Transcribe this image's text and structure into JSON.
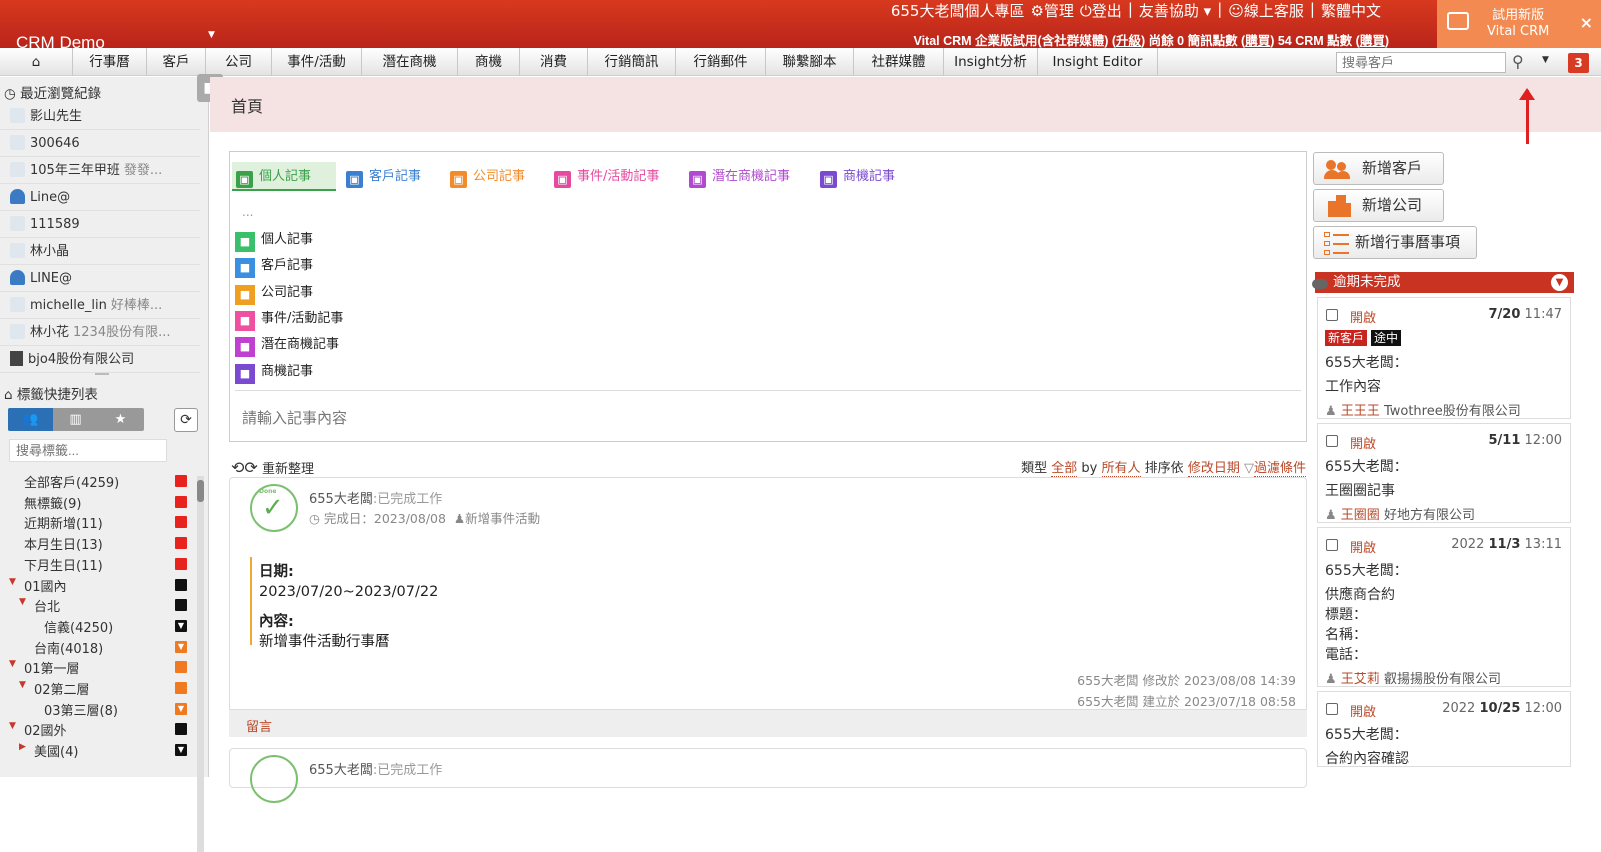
{
  "app": {
    "logo": "CRM Demo",
    "top_links": [
      "655大老闆個人專區",
      "管理",
      "登出",
      "|",
      "友善協助",
      "|",
      "線上客服",
      "|",
      "繁體中文"
    ],
    "account_line_pre": "Vital CRM 企業版試用(含社群媒體) (",
    "account_upgrade": "升級",
    "account_mid": ") 尚餘 0 簡訊點數 (",
    "account_buy1": "購買",
    "account_mid2": ") 54 CRM 點數 (",
    "account_buy2": "購買",
    "account_post": ")",
    "try_new_line1": "試用新版",
    "try_new_line2": "Vital CRM",
    "close": "×",
    "notif_count": "3"
  },
  "nav": [
    "行事曆",
    "客戶",
    "公司",
    "事件/活動",
    "潛在商機",
    "商機",
    "消費",
    "行銷簡訊",
    "行銷郵件",
    "聯繫腳本",
    "社群媒體",
    "Insight分析",
    "Insight Editor"
  ],
  "search": {
    "placeholder": "搜尋客戶"
  },
  "sidebar": {
    "recent_title": "最近瀏覽紀錄",
    "recent": [
      {
        "name": "影山先生",
        "sub": "",
        "type": "person"
      },
      {
        "name": "300646",
        "sub": "",
        "type": "person"
      },
      {
        "name": "105年三年甲班",
        "sub": "發發...",
        "type": "person"
      },
      {
        "name": "Line@",
        "sub": "",
        "type": "group"
      },
      {
        "name": "111589",
        "sub": "",
        "type": "person"
      },
      {
        "name": "林小晶",
        "sub": "",
        "type": "person"
      },
      {
        "name": "LINE@",
        "sub": "",
        "type": "group"
      },
      {
        "name": "michelle_lin",
        "sub": "好棒棒...",
        "type": "person"
      },
      {
        "name": "林小花",
        "sub": "1234股份有限...",
        "type": "person"
      },
      {
        "name": "bjo4股份有限公司",
        "sub": "",
        "type": "company"
      }
    ],
    "tags_title": "標籤快捷列表",
    "tag_search_placeholder": "搜尋標籤...",
    "tags": [
      {
        "label": "全部客戶(4259)",
        "indent": 0,
        "arrow": "",
        "color": "#e8231d",
        "mark": ""
      },
      {
        "label": "無標籤(9)",
        "indent": 0,
        "arrow": "",
        "color": "#e8231d",
        "mark": ""
      },
      {
        "label": "近期新增(11)",
        "indent": 0,
        "arrow": "",
        "color": "#e8231d",
        "mark": ""
      },
      {
        "label": "本月生日(13)",
        "indent": 0,
        "arrow": "",
        "color": "#e8231d",
        "mark": ""
      },
      {
        "label": "下月生日(11)",
        "indent": 0,
        "arrow": "",
        "color": "#e8231d",
        "mark": ""
      },
      {
        "label": "01國內",
        "indent": 0,
        "arrow": "down",
        "color": "#111111",
        "mark": ""
      },
      {
        "label": "台北",
        "indent": 1,
        "arrow": "down",
        "color": "#111111",
        "mark": ""
      },
      {
        "label": "信義(4250)",
        "indent": 2,
        "arrow": "",
        "color": "#111111",
        "mark": "tri"
      },
      {
        "label": "台南(4018)",
        "indent": 1,
        "arrow": "",
        "color": "#f07a22",
        "mark": "tri"
      },
      {
        "label": "01第一層",
        "indent": 0,
        "arrow": "down",
        "color": "#f07a22",
        "mark": ""
      },
      {
        "label": "02第二層",
        "indent": 1,
        "arrow": "down",
        "color": "#f07a22",
        "mark": ""
      },
      {
        "label": "03第三層(8)",
        "indent": 2,
        "arrow": "",
        "color": "#f07a22",
        "mark": "tri"
      },
      {
        "label": "02國外",
        "indent": 0,
        "arrow": "down",
        "color": "#111111",
        "mark": ""
      },
      {
        "label": "美國(4)",
        "indent": 1,
        "arrow": "right",
        "color": "#111111",
        "mark": "tri"
      }
    ]
  },
  "page": {
    "title": "首頁"
  },
  "note_tabs": [
    {
      "label": "個人記事",
      "color": "#3aa04a",
      "bg": "#dff1dc"
    },
    {
      "label": "客戶記事",
      "color": "#3a7fd0",
      "bg": ""
    },
    {
      "label": "公司記事",
      "color": "#f08c2a",
      "bg": ""
    },
    {
      "label": "事件/活動記事",
      "color": "#e64aa0",
      "bg": ""
    },
    {
      "label": "潛在商機記事",
      "color": "#b04ad0",
      "bg": ""
    },
    {
      "label": "商機記事",
      "color": "#7a4ad0",
      "bg": ""
    }
  ],
  "note_dropdown": {
    "ellipsis": "...",
    "items": [
      {
        "label": "個人記事",
        "color": "#3ac06a"
      },
      {
        "label": "客戶記事",
        "color": "#3a8fe0"
      },
      {
        "label": "公司記事",
        "color": "#f0a020"
      },
      {
        "label": "事件/活動記事",
        "color": "#f050a0"
      },
      {
        "label": "潛在商機記事",
        "color": "#c040d0"
      },
      {
        "label": "商機記事",
        "color": "#7a4ad0"
      }
    ]
  },
  "note_input_placeholder": "請輸入記事內容",
  "feed": {
    "refresh": "重新整理",
    "type_label": "類型",
    "type_value": "全部",
    "by_label": "by",
    "by_value": "所有人",
    "sort_label": "排序依",
    "sort_value": "修改日期",
    "filter": "過濾條件",
    "card": {
      "author": "655大老闆",
      "status": ":已完成工作",
      "done_label": "完成日：2023/08/08",
      "event": "新增事件活動",
      "date_label": "日期:",
      "date_value": "2023/07/20~2023/07/22",
      "content_label": "內容:",
      "content_value": "新增事件活動行事曆",
      "modified": "655大老闆 修改於 2023/08/08 14:39",
      "created": "655大老闆 建立於 2023/07/18 08:58",
      "comment": "留言",
      "done_badge": "Done"
    },
    "card2": {
      "author": "655大老闆",
      "status": ":已完成工作"
    }
  },
  "right": {
    "buttons": [
      "新增客戶",
      "新增公司",
      "新增行事曆事項"
    ],
    "overdue_title": "逾期未完成",
    "tasks": [
      {
        "status": "開啟",
        "date_pre": "",
        "date_bold": "7/20",
        "time": "11:47",
        "tags": [
          "新客戶",
          "途中"
        ],
        "owner": "655大老闆：",
        "lines": [
          "工作內容"
        ],
        "person": "王王王",
        "company": "Twothree股份有限公司"
      },
      {
        "status": "開啟",
        "date_pre": "",
        "date_bold": "5/11",
        "time": "12:00",
        "tags": [],
        "owner": "655大老闆：",
        "lines": [
          "王圈圈記事"
        ],
        "person": "王圈圈",
        "company": "好地方有限公司"
      },
      {
        "status": "開啟",
        "date_pre": "2022",
        "date_bold": "11/3",
        "time": "13:11",
        "tags": [],
        "owner": "655大老闆：",
        "lines": [
          "供應商合約",
          "標題：",
          "名稱：",
          "電話："
        ],
        "person": "王艾莉",
        "company": "叡揚揚股份有限公司"
      },
      {
        "status": "開啟",
        "date_pre": "2022",
        "date_bold": "10/25",
        "time": "12:00",
        "tags": [],
        "owner": "655大老闆：",
        "lines": [
          "合約內容確認"
        ],
        "person": "",
        "company": ""
      }
    ]
  }
}
